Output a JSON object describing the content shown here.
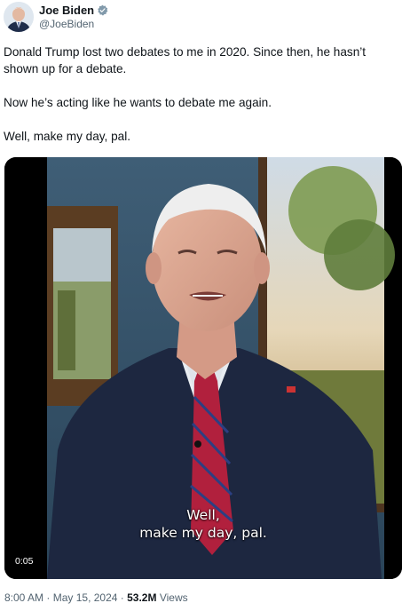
{
  "author": {
    "display_name": "Joe Biden",
    "handle": "@JoeBiden",
    "verified_icon": "government-verified-badge-icon",
    "badge_color": "#829aab"
  },
  "tweet": {
    "paragraphs": [
      "Donald Trump lost two debates to me in 2020. Since then, he hasn’t shown up for a debate.",
      "Now he’s acting like he wants to debate me again.",
      "Well, make my day, pal."
    ]
  },
  "video": {
    "caption_line1": "Well,",
    "caption_line2": "make my day, pal.",
    "timecode": "0:05"
  },
  "meta": {
    "time": "8:00 AM",
    "separator": "·",
    "date": "May 15, 2024",
    "views_count": "53.2M",
    "views_label": "Views"
  }
}
